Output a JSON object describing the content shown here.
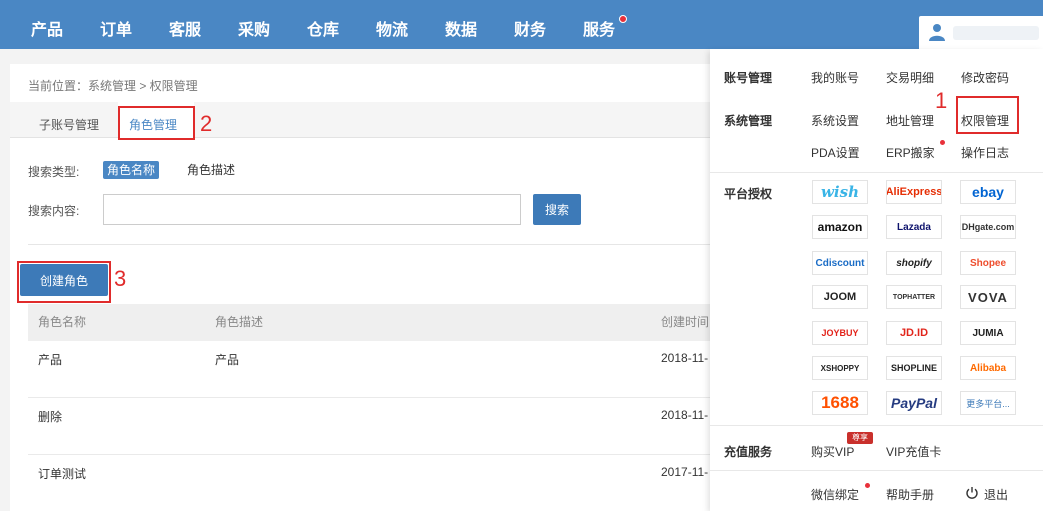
{
  "nav": {
    "items": [
      "产品",
      "订单",
      "客服",
      "采购",
      "仓库",
      "物流",
      "数据",
      "财务",
      "服务"
    ]
  },
  "breadcrumb": "当前位置：系统管理 > 权限管理",
  "tabs": [
    "子账号管理",
    "角色管理"
  ],
  "annotations": [
    "1",
    "2",
    "3"
  ],
  "search": {
    "type_label": "搜索类型:",
    "type_options": [
      "角色名称",
      "角色描述"
    ],
    "content_label": "搜索内容:",
    "input_value": "",
    "button_label": "搜索"
  },
  "create_button": "创建角色",
  "table": {
    "headers": [
      "角色名称",
      "角色描述",
      "创建时间"
    ],
    "rows": [
      [
        "产品",
        "产品",
        "2018-11-"
      ],
      [
        "删除",
        "",
        "2018-11-"
      ],
      [
        "订单测试",
        "",
        "2017-11-"
      ]
    ]
  },
  "dropdown": {
    "account": {
      "heading": "账号管理",
      "links": [
        "我的账号",
        "交易明细",
        "修改密码"
      ]
    },
    "system": {
      "heading": "系统管理",
      "links": [
        "系统设置",
        "地址管理",
        "权限管理",
        "PDA设置",
        "ERP搬家",
        "操作日志"
      ]
    },
    "platform": {
      "heading": "平台授权",
      "logos": [
        "wish",
        "AliExpress",
        "ebay",
        "amazon",
        "Lazada",
        "DHgate.com",
        "Cdiscount",
        "shopify",
        "Shopee",
        "JOOM",
        "TOPHATTER",
        "VOVA",
        "JOYBUY",
        "JD.ID",
        "JUMIA",
        "XSHOPPY",
        "SHOPLINE",
        "Alibaba",
        "1688",
        "PayPal",
        "更多平台..."
      ]
    },
    "recharge": {
      "heading": "充值服务",
      "links": [
        "购买VIP",
        "VIP充值卡"
      ],
      "vip_tag": "尊享"
    },
    "bottom_links": [
      "微信绑定",
      "帮助手册",
      "退出"
    ]
  },
  "colors": {
    "nav_bg": "#4a87c4",
    "button_bg": "#3d7ab8",
    "annotation_red": "#e02b2b",
    "dot_red": "#e8303a"
  }
}
